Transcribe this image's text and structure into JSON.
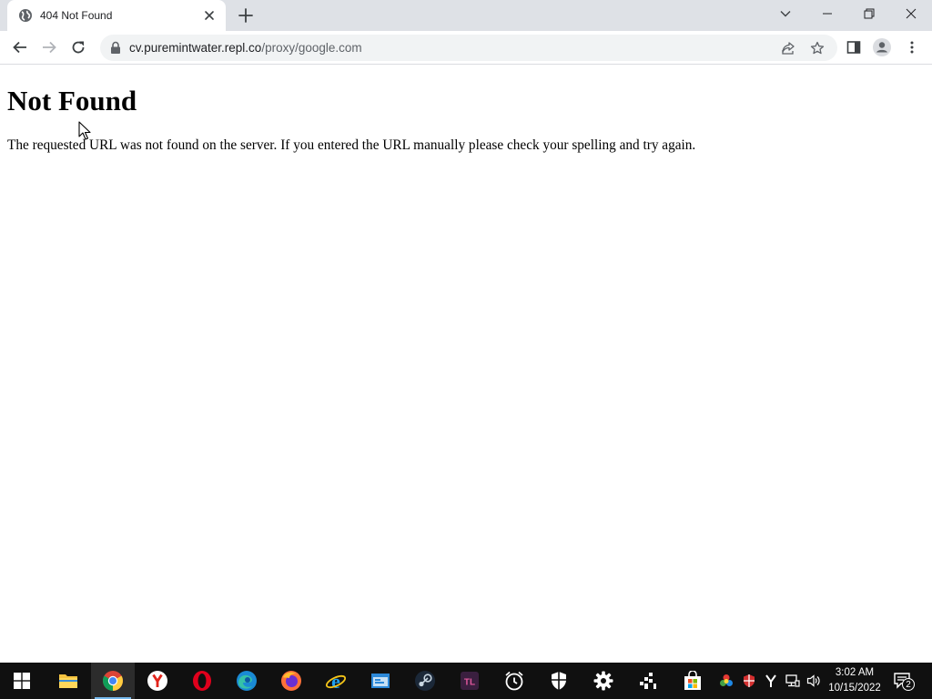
{
  "browser": {
    "tab": {
      "title": "404 Not Found"
    },
    "address": {
      "host": "cv.puremintwater.repl.co",
      "path": "/proxy/google.com"
    }
  },
  "page": {
    "heading": "Not Found",
    "message": "The requested URL was not found on the server. If you entered the URL manually please check your spelling and try again."
  },
  "taskbar": {
    "apps": [
      "start",
      "file-explorer",
      "chrome",
      "yandex-browser",
      "opera",
      "edge",
      "firefox",
      "internet-explorer",
      "windows-app",
      "steam",
      "app-tl",
      "alarm-clock",
      "windows-security",
      "settings",
      "xbox-game-bar",
      "microsoft-store"
    ],
    "active_app": "chrome",
    "tray": [
      "colorful-app",
      "shield-app",
      "yandex",
      "network",
      "volume"
    ],
    "clock": {
      "time": "3:02 AM",
      "date": "10/15/2022"
    },
    "notification_count": "2"
  },
  "colors": {
    "tabstrip": "#dee1e6",
    "omnibox": "#f1f3f4",
    "taskbar": "#101010",
    "taskbar_active_indicator": "#76b9ed"
  }
}
